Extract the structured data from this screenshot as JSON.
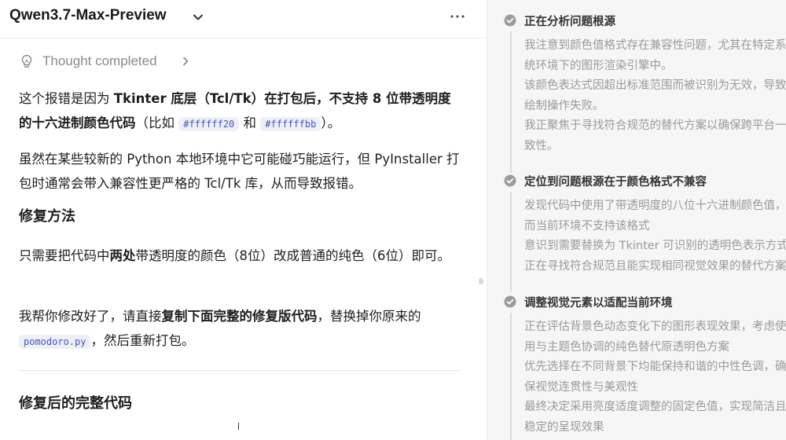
{
  "header": {
    "model_name": "Qwen3.7-Max-Preview",
    "chevron_icon": "chevron-down-icon",
    "more_icon": "more-horizontal-icon"
  },
  "thought": {
    "label": "Thought completed",
    "icon": "lightbulb-icon"
  },
  "message": {
    "p1": {
      "t1": "这个报错是因为 ",
      "b1": "Tkinter 底层（Tcl/Tk）在打包后，不支持 8 位带透明度的十六进制颜色代码",
      "t2": "（比如 ",
      "c1": "#ffffff20",
      "t3": " 和 ",
      "c2": "#ffffffbb",
      "t4": "）。"
    },
    "p2": "虽然在某些较新的 Python 本地环境中它可能碰巧能运行，但 PyInstaller 打包时通常会带入兼容性更严格的 Tcl/Tk 库，从而导致报错。",
    "h_fix": "修复方法",
    "p3": {
      "t1": "只需要把代码中",
      "b1": "两处",
      "t2": "带透明度的颜色（8位）改成普通的纯色（6位）即可。"
    },
    "p4": {
      "t1": "我帮你修改好了，请直接",
      "b1": "复制下面完整的修复版代码",
      "t2": "，替换掉你原来的 ",
      "c1": "pomodoro.py",
      "t3": "，然后重新打包。"
    },
    "h_code": "修复后的完整代码"
  },
  "reasoning": {
    "steps": [
      {
        "title": "正在分析问题根源",
        "lines": [
          "我注意到颜色值格式存在兼容性问题，尤其在特定系",
          "统环境下的图形渲染引擎中。",
          "该颜色表达式因超出标准范围而被识别为无效，导致",
          "绘制操作失败。",
          "我正聚焦于寻找符合规范的替代方案以确保跨平台一",
          "致性。"
        ]
      },
      {
        "title": "定位到问题根源在于颜色格式不兼容",
        "lines": [
          "发现代码中使用了带透明度的八位十六进制颜色值，",
          "而当前环境不支持该格式",
          "意识到需要替换为 Tkinter 可识别的透明色表示方式",
          "正在寻找符合规范且能实现相同视觉效果的替代方案"
        ]
      },
      {
        "title": "调整视觉元素以适配当前环境",
        "lines": [
          "正在评估背景色动态变化下的图形表现效果，考虑使",
          "用与主题色协调的纯色替代原透明色方案",
          "优先选择在不同背景下均能保持和谐的中性色调，确",
          "保视觉连贯性与美观性",
          "最终决定采用亮度适度调整的固定色值，实现简洁且",
          "稳定的呈现效果"
        ]
      }
    ]
  },
  "colors": {
    "inline_code_bg": "#eef0f8",
    "inline_code_text": "#4a53b8",
    "right_panel_bg": "#f6f6f7",
    "check_icon": "#9b9b9b"
  }
}
